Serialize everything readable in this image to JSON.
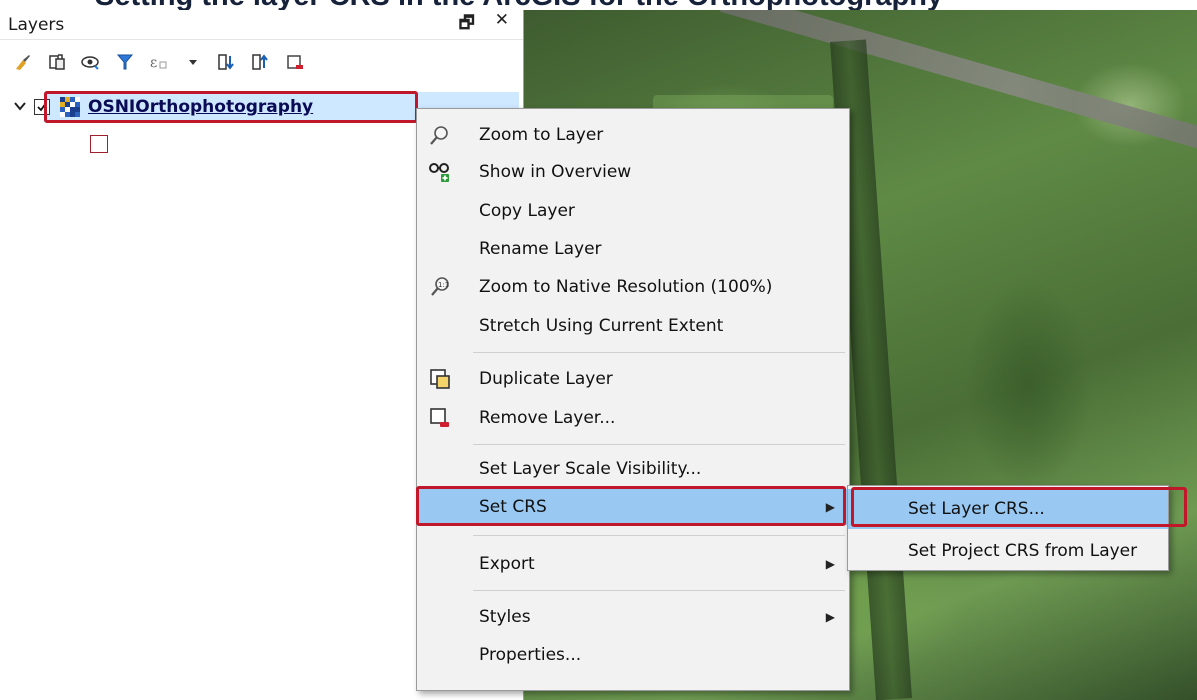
{
  "heading_sliver": "Setting the layer CRS in the ArcGIS for the Orthophotography",
  "layers_panel": {
    "title": "Layers",
    "float_glyph": "🗗",
    "close_glyph": "✕",
    "toolbar_icons": [
      "add-layer-icon",
      "style-icon",
      "visibility-icon",
      "filter-icon",
      "expression-icon",
      "dropdown-icon",
      "expand-all-icon",
      "collapse-all-icon",
      "remove-layer-icon"
    ]
  },
  "layer": {
    "name": "OSNIOrthophotography",
    "checked": true
  },
  "context_menu": {
    "items": [
      {
        "label": "Zoom to Layer",
        "icon": "zoom-magnifier-icon"
      },
      {
        "label": "Show in Overview",
        "icon": "overview-glasses-icon"
      },
      {
        "label": "Copy Layer",
        "icon": ""
      },
      {
        "label": "Rename Layer",
        "icon": ""
      },
      {
        "label": "Zoom to Native Resolution (100%)",
        "icon": "native-resolution-icon"
      },
      {
        "label": "Stretch Using Current Extent",
        "icon": ""
      },
      {
        "label": "Duplicate Layer",
        "icon": "duplicate-icon"
      },
      {
        "label": "Remove Layer...",
        "icon": "remove-icon"
      },
      {
        "label": "Set Layer Scale Visibility...",
        "icon": ""
      },
      {
        "label": "Set CRS",
        "icon": "",
        "submenu": true
      },
      {
        "label": "Export",
        "icon": "",
        "submenu": true
      },
      {
        "label": "Styles",
        "icon": "",
        "submenu": true
      },
      {
        "label": "Properties...",
        "icon": ""
      }
    ]
  },
  "submenu": {
    "items": [
      {
        "label": "Set Layer CRS..."
      },
      {
        "label": "Set Project CRS from Layer"
      }
    ]
  },
  "colors": {
    "highlight": "#99c9f3",
    "annotation_red": "#c0182a",
    "menu_bg": "#f2f2f2"
  }
}
